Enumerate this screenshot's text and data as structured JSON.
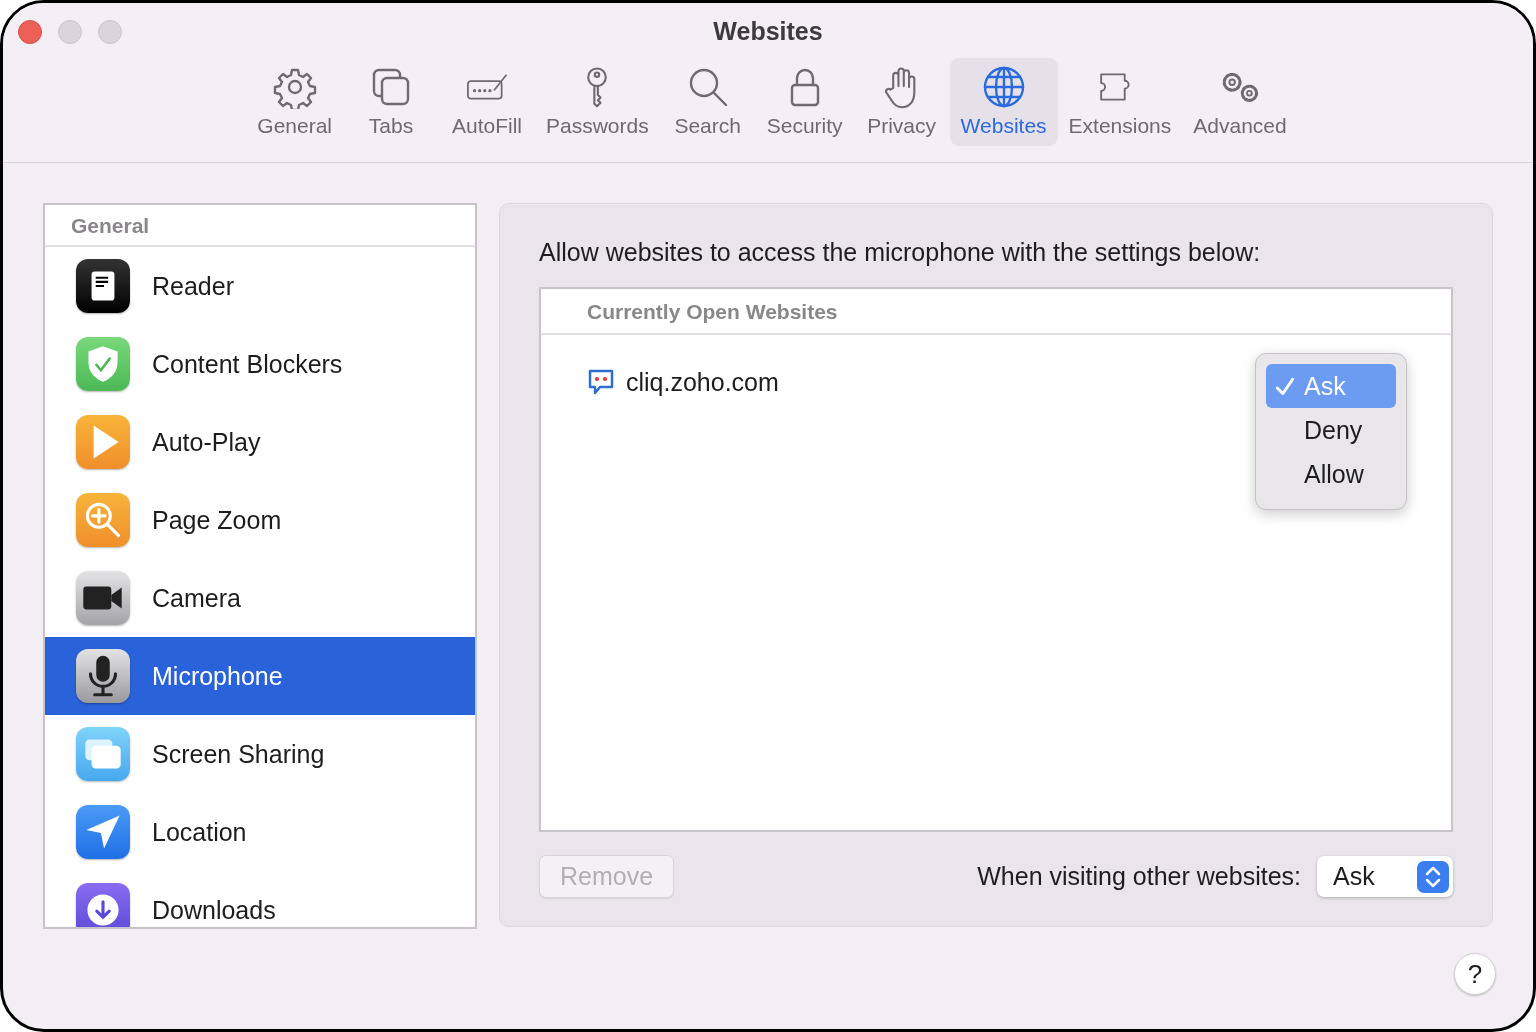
{
  "window": {
    "title": "Websites"
  },
  "toolbar": [
    {
      "label": "General",
      "selected": false
    },
    {
      "label": "Tabs",
      "selected": false
    },
    {
      "label": "AutoFill",
      "selected": false
    },
    {
      "label": "Passwords",
      "selected": false
    },
    {
      "label": "Search",
      "selected": false
    },
    {
      "label": "Security",
      "selected": false
    },
    {
      "label": "Privacy",
      "selected": false
    },
    {
      "label": "Websites",
      "selected": true
    },
    {
      "label": "Extensions",
      "selected": false
    },
    {
      "label": "Advanced",
      "selected": false
    }
  ],
  "sidebar": {
    "section": "General",
    "items": [
      {
        "label": "Reader",
        "selected": false
      },
      {
        "label": "Content Blockers",
        "selected": false
      },
      {
        "label": "Auto-Play",
        "selected": false
      },
      {
        "label": "Page Zoom",
        "selected": false
      },
      {
        "label": "Camera",
        "selected": false
      },
      {
        "label": "Microphone",
        "selected": true
      },
      {
        "label": "Screen Sharing",
        "selected": false
      },
      {
        "label": "Location",
        "selected": false
      },
      {
        "label": "Downloads",
        "selected": false
      }
    ]
  },
  "panel": {
    "description": "Allow websites to access the microphone with the settings below:",
    "table": {
      "column": "Currently Open Websites",
      "rows": [
        {
          "site": "cliq.zoho.com"
        }
      ]
    },
    "menu": {
      "options": [
        {
          "label": "Ask",
          "selected": true
        },
        {
          "label": "Deny",
          "selected": false
        },
        {
          "label": "Allow",
          "selected": false
        }
      ]
    },
    "remove_button": {
      "label": "Remove",
      "disabled": true
    },
    "default_setting": {
      "label": "When visiting other websites:",
      "value": "Ask"
    }
  },
  "help": {
    "label": "?"
  }
}
